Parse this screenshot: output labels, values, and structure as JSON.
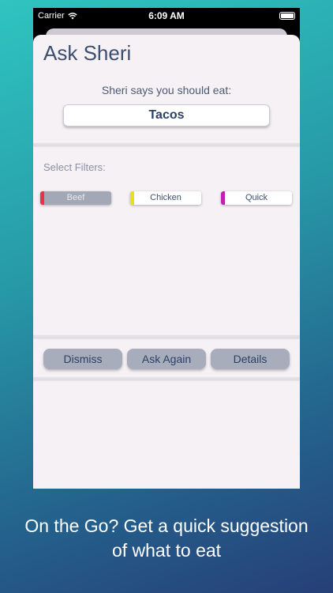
{
  "status_bar": {
    "carrier": "Carrier",
    "time": "6:09 AM"
  },
  "sheet": {
    "title": "Ask Sheri",
    "subtitle": "Sheri says you should eat:",
    "result": "Tacos"
  },
  "filters": {
    "label": "Select Filters:",
    "items": [
      {
        "label": "Beef",
        "color": "#e8324a",
        "selected": false
      },
      {
        "label": "Chicken",
        "color": "#e3e21f",
        "selected": true
      },
      {
        "label": "Quick",
        "color": "#c21fb0",
        "selected": true
      }
    ]
  },
  "actions": {
    "dismiss": "Dismiss",
    "ask_again": "Ask Again",
    "details": "Details"
  },
  "caption": {
    "line1": "On the Go? Get a quick suggestion",
    "line2": "of what to eat"
  }
}
